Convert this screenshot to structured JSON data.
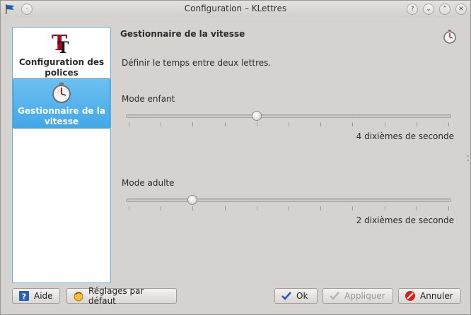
{
  "window": {
    "title": "Configuration – KLettres"
  },
  "titlebar_buttons": [
    {
      "name": "help",
      "glyph": "?"
    },
    {
      "name": "minimize",
      "glyph": "⌄"
    },
    {
      "name": "maximize",
      "glyph": "⌃"
    },
    {
      "name": "close",
      "glyph": "✕"
    }
  ],
  "sidebar": {
    "items": [
      {
        "label": "Configuration des polices",
        "icon": "font-icon",
        "selected": false
      },
      {
        "label": "Gestionnaire de la vitesse",
        "icon": "stopwatch-icon",
        "selected": true
      }
    ]
  },
  "page": {
    "title": "Gestionnaire de la vitesse",
    "description": "Définir le temps entre deux lettres.",
    "child": {
      "label": "Mode enfant",
      "value": 4,
      "min": 0,
      "max": 10,
      "value_text": "4 dixièmes de seconde"
    },
    "adult": {
      "label": "Mode adulte",
      "value": 2,
      "min": 0,
      "max": 10,
      "value_text": "2 dixièmes de seconde"
    }
  },
  "buttons": {
    "help": "Aide",
    "defaults": "Réglages par défaut",
    "ok": "Ok",
    "apply": "Appliquer",
    "cancel": "Annuler"
  },
  "colors": {
    "selection": "#43a8e8",
    "window_bg": "#d6d2d0"
  }
}
